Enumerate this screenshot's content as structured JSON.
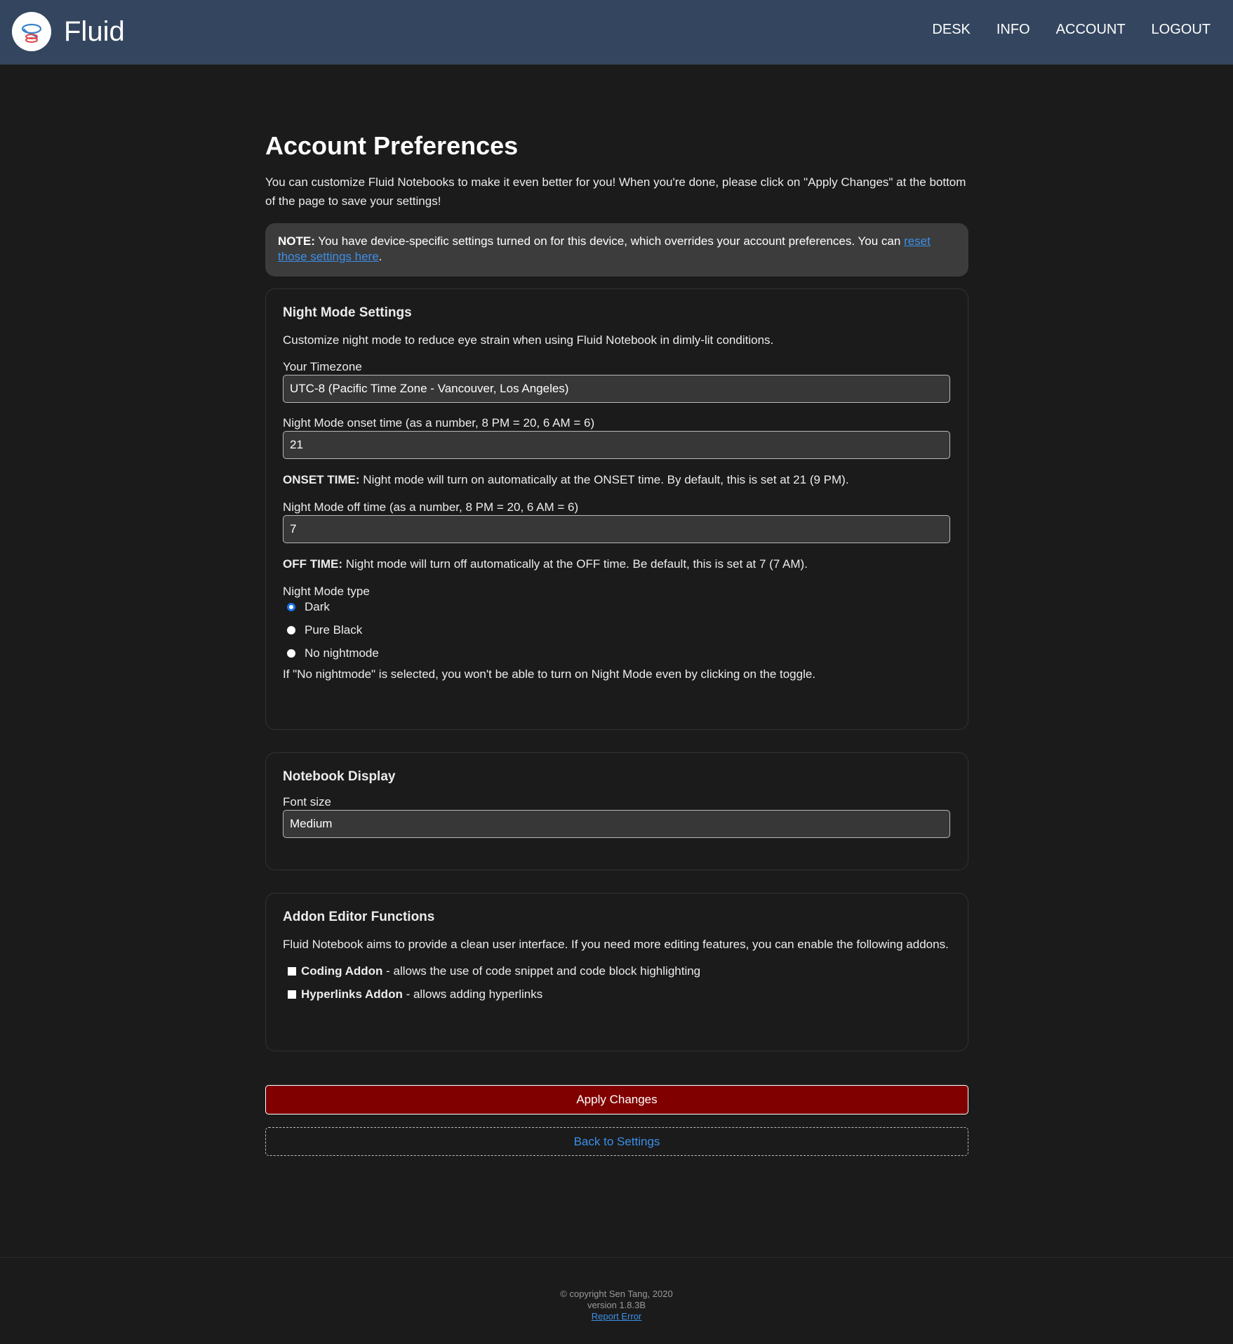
{
  "header": {
    "brand": "Fluid",
    "nav": [
      "DESK",
      "INFO",
      "ACCOUNT",
      "LOGOUT"
    ]
  },
  "page": {
    "title": "Account Preferences",
    "intro": "You can customize Fluid Notebooks to make it even better for you! When you're done, please click on \"Apply Changes\" at the bottom of the page to save your settings!"
  },
  "note": {
    "label": "NOTE:",
    "text": " You have device-specific settings turned on for this device, which overrides your account preferences. You can ",
    "link": "reset those settings here",
    "end": "."
  },
  "night_mode": {
    "heading": "Night Mode Settings",
    "description": "Customize night mode to reduce eye strain when using Fluid Notebook in dimly-lit conditions.",
    "timezone_label": "Your Timezone",
    "timezone_value": "UTC-8 (Pacific Time Zone - Vancouver, Los Angeles)",
    "onset_label": "Night Mode onset time (as a number, 8 PM = 20, 6 AM = 6)",
    "onset_value": "21",
    "onset_note_label": "ONSET TIME:",
    "onset_note": " Night mode will turn on automatically at the ONSET time. By default, this is set at 21 (9 PM).",
    "off_label": "Night Mode off time (as a number, 8 PM = 20, 6 AM = 6)",
    "off_value": "7",
    "off_note_label": "OFF TIME:",
    "off_note": " Night mode will turn off automatically at the OFF time. Be default, this is set at 7 (7 AM).",
    "type_label": "Night Mode type",
    "options": [
      "Dark",
      "Pure Black",
      "No nightmode"
    ],
    "selected": "Dark",
    "type_note": "If \"No nightmode\" is selected, you won't be able to turn on Night Mode even by clicking on the toggle."
  },
  "notebook_display": {
    "heading": "Notebook Display",
    "font_size_label": "Font size",
    "font_size_value": "Medium"
  },
  "addons": {
    "heading": "Addon Editor Functions",
    "description": "Fluid Notebook aims to provide a clean user interface. If you need more editing features, you can enable the following addons.",
    "items": [
      {
        "name": "Coding Addon",
        "desc": " - allows the use of code snippet and code block highlighting",
        "checked": false
      },
      {
        "name": "Hyperlinks Addon",
        "desc": " - allows adding hyperlinks",
        "checked": false
      }
    ]
  },
  "actions": {
    "apply": "Apply Changes",
    "back": "Back to Settings"
  },
  "footer": {
    "copyright": "© copyright Sen Tang, 2020",
    "version": "version 1.8.3B",
    "report": "Report Error"
  },
  "colors": {
    "header_bg": "#34465f",
    "page_bg": "#1b1b1b",
    "apply_bg": "#800000",
    "link": "#3d8fe8"
  }
}
